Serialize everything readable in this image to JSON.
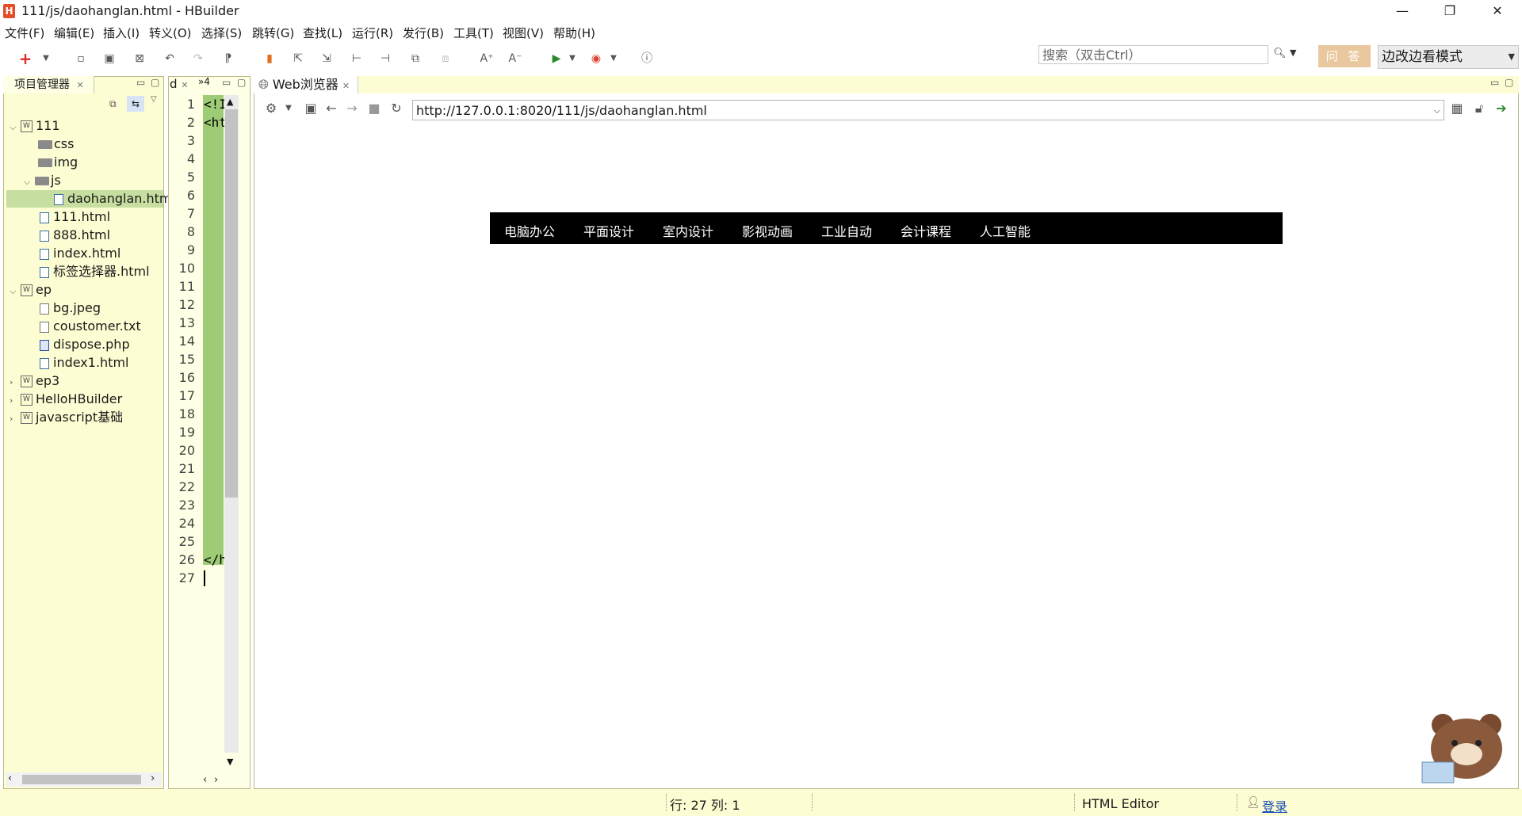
{
  "window": {
    "title": "111/js/daohanglan.html  - HBuilder"
  },
  "menu": [
    "文件(F)",
    "编辑(E)",
    "插入(I)",
    "转义(O)",
    "选择(S)",
    "跳转(G)",
    "查找(L)",
    "运行(R)",
    "发行(B)",
    "工具(T)",
    "视图(V)",
    "帮助(H)"
  ],
  "toolbar": {
    "search_placeholder": "搜索（双击Ctrl）",
    "ask_label": "问 答",
    "mode_label": "边改边看模式"
  },
  "project_panel": {
    "tab_label": "项目管理器",
    "tree": [
      {
        "label": "111",
        "type": "project",
        "level": 0,
        "expanded": true
      },
      {
        "label": "css",
        "type": "folder",
        "level": 1
      },
      {
        "label": "img",
        "type": "folder",
        "level": 1
      },
      {
        "label": "js",
        "type": "folder",
        "level": 1,
        "expanded": true
      },
      {
        "label": "daohanglan.htm",
        "type": "file",
        "level": 2,
        "selected": true
      },
      {
        "label": "111.html",
        "type": "file",
        "level": 1
      },
      {
        "label": "888.html",
        "type": "file",
        "level": 1
      },
      {
        "label": "index.html",
        "type": "file",
        "level": 1
      },
      {
        "label": "标签选择器.html",
        "type": "file",
        "level": 1
      },
      {
        "label": "ep",
        "type": "project",
        "level": 0,
        "expanded": true
      },
      {
        "label": "bg.jpeg",
        "type": "file",
        "level": 1
      },
      {
        "label": "coustomer.txt",
        "type": "file",
        "level": 1
      },
      {
        "label": "dispose.php",
        "type": "file",
        "level": 1
      },
      {
        "label": "index1.html",
        "type": "file",
        "level": 1
      },
      {
        "label": "ep3",
        "type": "project",
        "level": 0
      },
      {
        "label": "HelloHBuilder",
        "type": "project",
        "level": 0
      },
      {
        "label": "javascript基础",
        "type": "project",
        "level": 0
      }
    ]
  },
  "editor": {
    "tab_label": "d",
    "tab_overflow": "»4",
    "line_numbers": [
      "1",
      "2",
      "3",
      "4",
      "5",
      "6",
      "7",
      "8",
      "9",
      "10",
      "11",
      "12",
      "13",
      "14",
      "15",
      "16",
      "17",
      "18",
      "19",
      "20",
      "21",
      "22",
      "23",
      "24",
      "25",
      "26",
      "27"
    ],
    "code_line1": "<!I",
    "code_line2": "<ht",
    "code_line26": "</h"
  },
  "browser": {
    "tab_label": "Web浏览器",
    "url": "http://127.0.0.1:8020/111/js/daohanglan.html",
    "nav_items": [
      "电脑办公",
      "平面设计",
      "室内设计",
      "影视动画",
      "工业自动",
      "会计课程",
      "人工智能"
    ]
  },
  "status": {
    "position": "行: 27 列: 1",
    "editor_type": "HTML Editor",
    "login": "登录"
  }
}
